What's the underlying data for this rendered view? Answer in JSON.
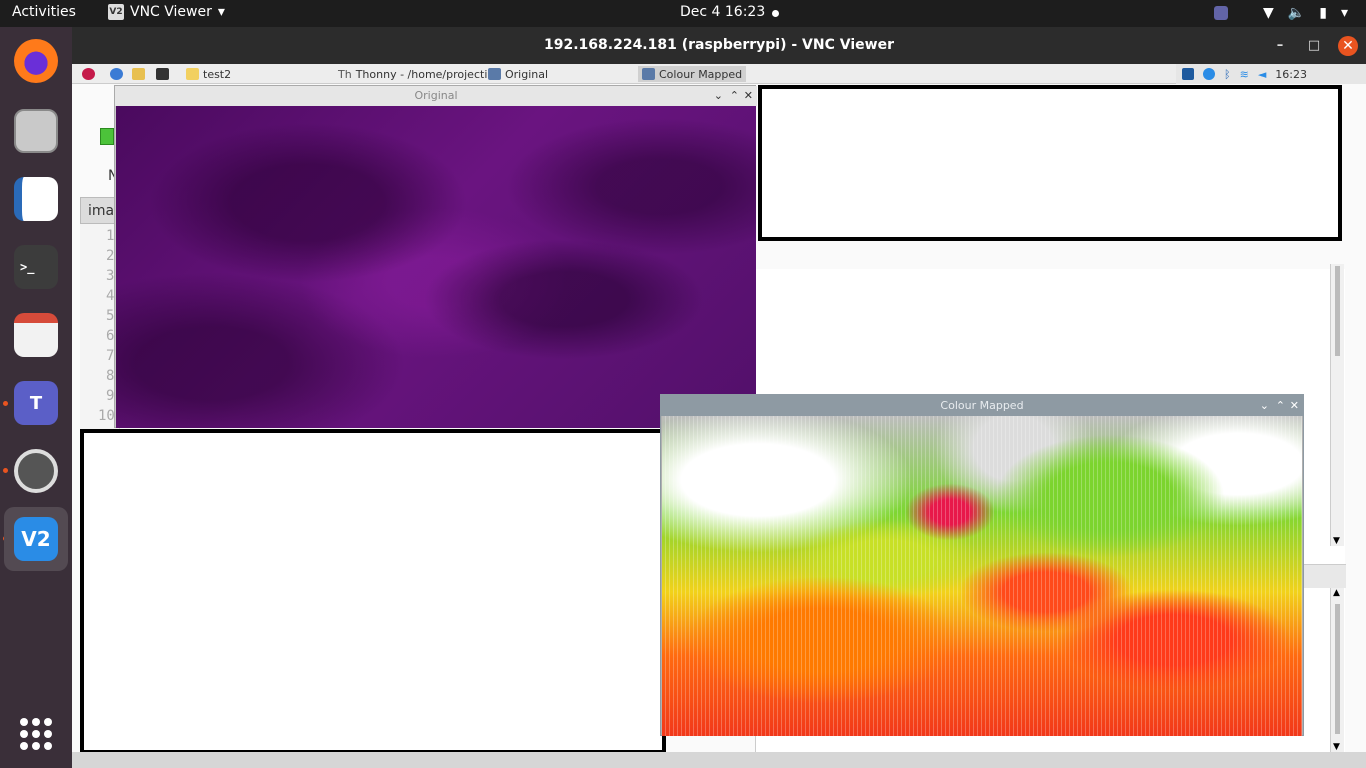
{
  "topbar": {
    "activities": "Activities",
    "app_name": "VNC Viewer",
    "app_icon": "V2",
    "clock": "Dec 4  16:23"
  },
  "vnc": {
    "title": "192.168.224.181 (raspberrypi) - VNC Viewer",
    "minimize": "–",
    "maximize": "□",
    "close": "✕"
  },
  "pi_panel": {
    "tasks": [
      {
        "label": "test2"
      },
      {
        "label": "Thonny  -  /home/projecti..."
      },
      {
        "label": "Original"
      },
      {
        "label": "Colour Mapped"
      }
    ],
    "time": "16:23"
  },
  "thonny": {
    "tab_label": "ima",
    "partial_label": "N",
    "line_numbers": [
      "1",
      "2",
      "3",
      "4",
      "5",
      "6",
      "7",
      "8",
      "9",
      "10"
    ]
  },
  "original_window": {
    "title": "Original"
  },
  "colour_window": {
    "title": "Colour Mapped"
  },
  "colors": {
    "ubuntu_orange": "#e95420",
    "dock_bg": "#3a2f39",
    "topbar_bg": "#1d1d1d"
  }
}
